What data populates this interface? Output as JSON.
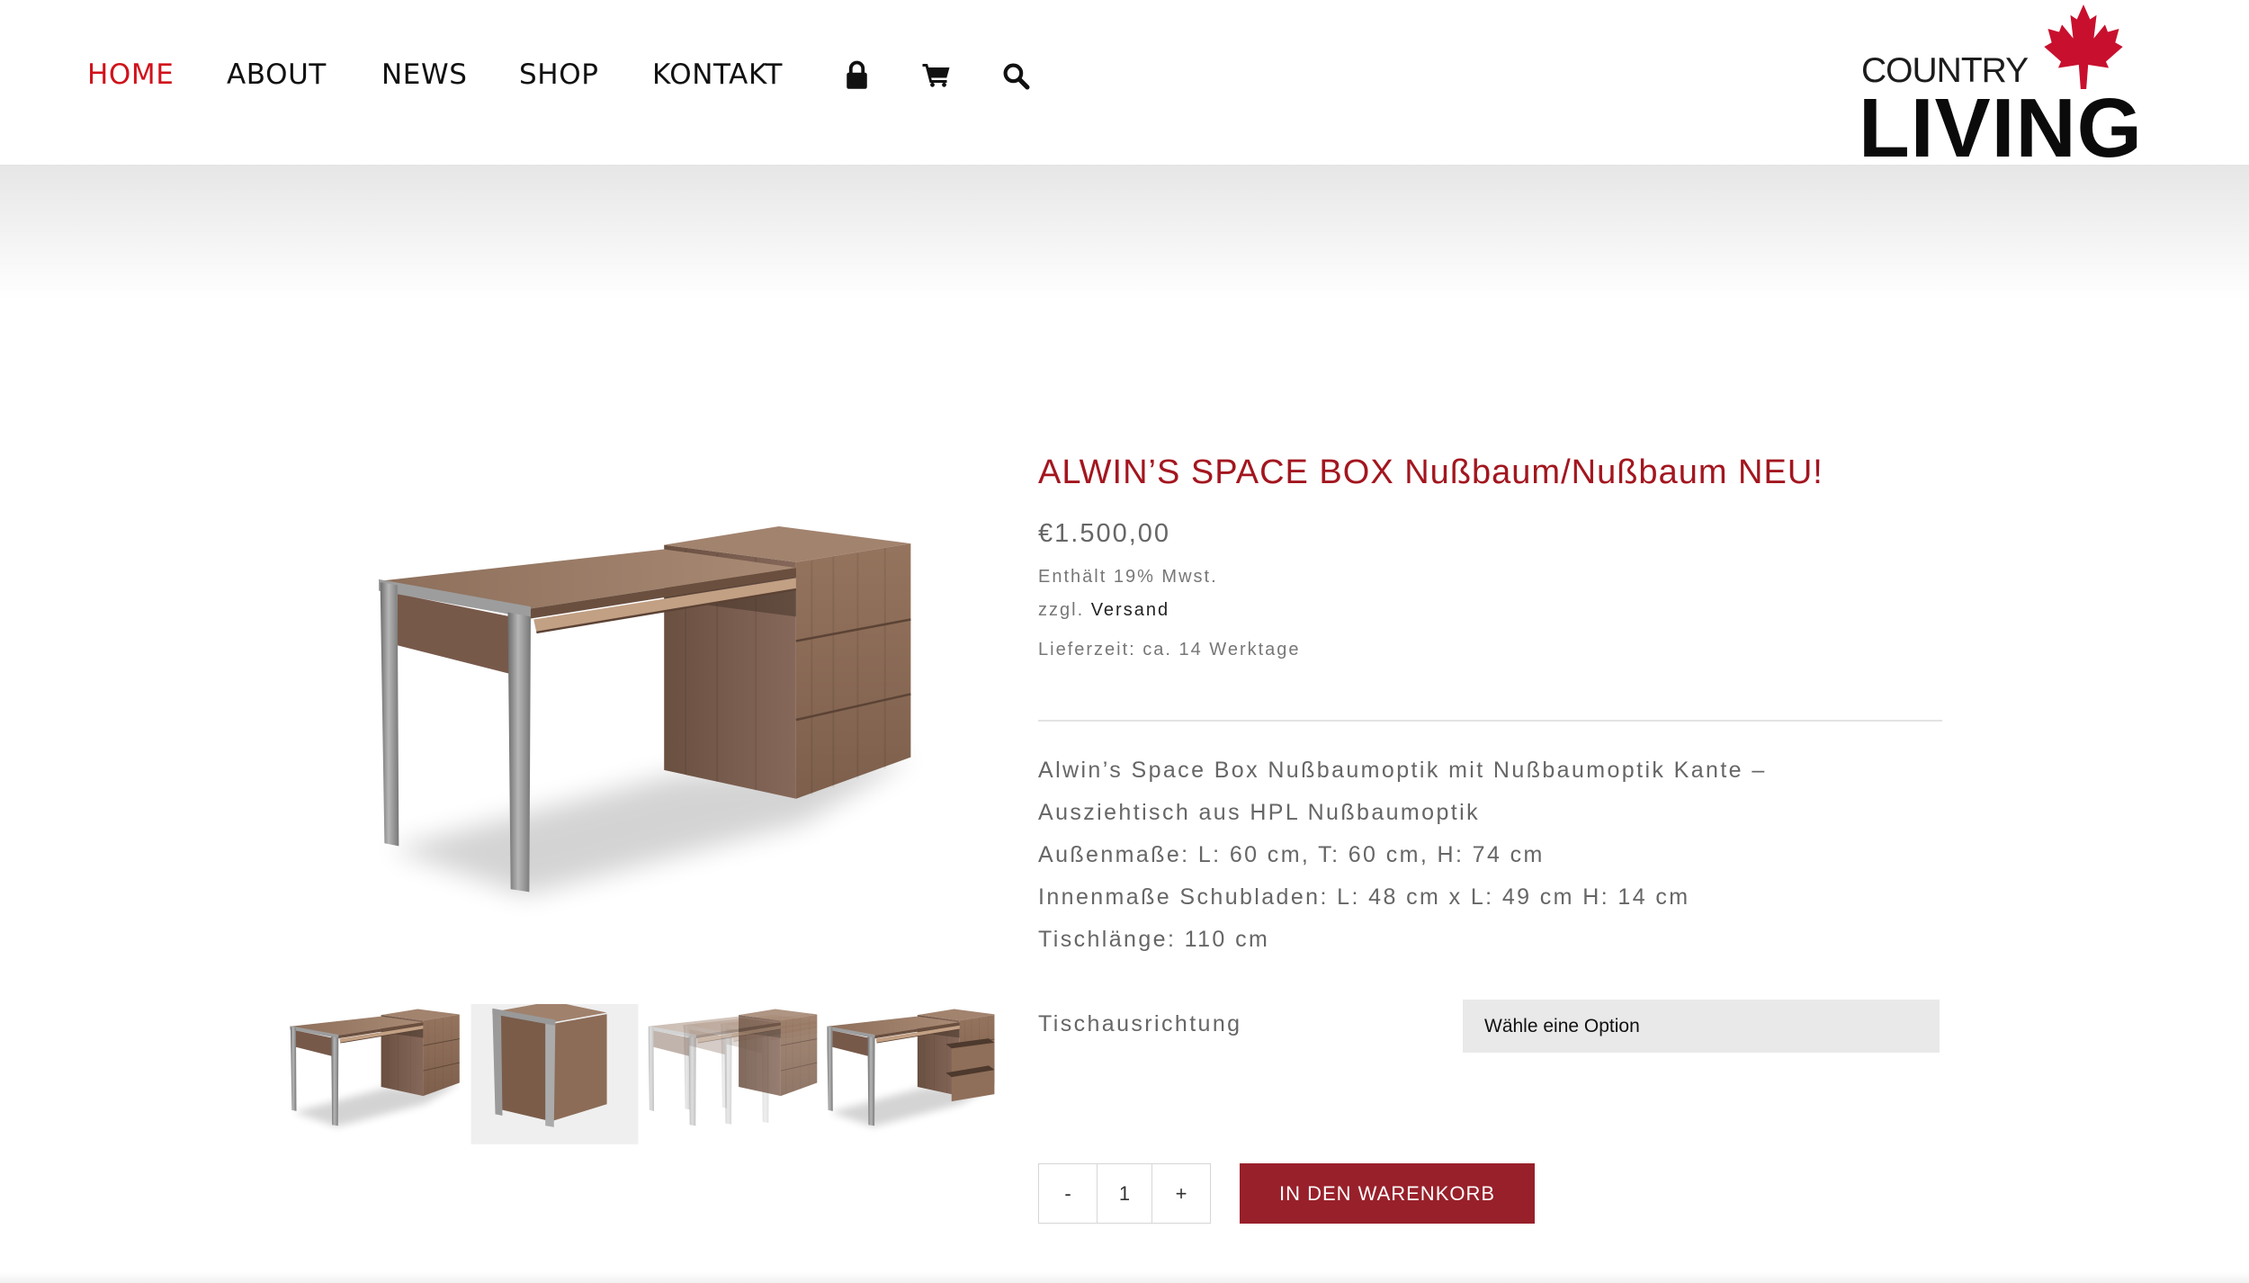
{
  "header": {
    "nav": [
      {
        "label": "HOME",
        "active": true
      },
      {
        "label": "ABOUT",
        "active": false
      },
      {
        "label": "NEWS",
        "active": false
      },
      {
        "label": "SHOP",
        "active": false
      },
      {
        "label": "KONTAKT",
        "active": false
      }
    ],
    "icons": [
      "lock-icon",
      "cart-icon",
      "search-icon"
    ],
    "logo": {
      "top": "COUNTRY",
      "bottom": "LIVING",
      "emblem": "maple-leaf-icon"
    }
  },
  "colors": {
    "nav_active": "#d0121b",
    "title": "#a3161f",
    "button": "#98202a",
    "body_text": "#666666",
    "logo_leaf": "#c8102e"
  },
  "product": {
    "title": "ALWIN’S SPACE BOX Nußbaum/Nußbaum NEU!",
    "price": "€1.500,00",
    "tax_note": "Enthält 19% Mwst.",
    "shipping_prefix": "zzgl.",
    "shipping_link": "Versand",
    "delivery": "Lieferzeit: ca. 14 Werktage",
    "description": [
      "Alwin’s Space Box Nußbaumoptik mit Nußbaumoptik Kante –",
      "Ausziehtisch aus HPL Nußbaumoptik",
      "Außenmaße: L: 60 cm, T: 60 cm, H: 74 cm",
      "Innenmaße Schubladen: L: 48 cm x L: 49 cm H: 14 cm",
      "Tischlänge: 110 cm"
    ],
    "variation": {
      "label": "Tischausrichtung",
      "placeholder": "Wähle eine Option"
    },
    "quantity": {
      "minus": "-",
      "value": "1",
      "plus": "+"
    },
    "add_to_cart": "IN DEN WARENKORB"
  }
}
